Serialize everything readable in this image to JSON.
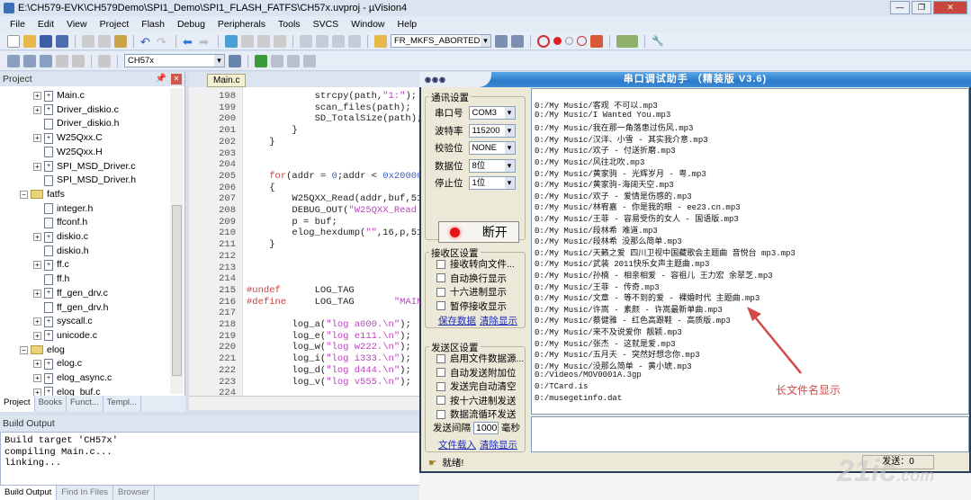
{
  "window": {
    "title": "E:\\CH579-EVK\\CH579Demo\\SPI1_Demo\\SPI1_FLASH_FATFS\\CH57x.uvproj - µVision4"
  },
  "menu": [
    "File",
    "Edit",
    "View",
    "Project",
    "Flash",
    "Debug",
    "Peripherals",
    "Tools",
    "SVCS",
    "Window",
    "Help"
  ],
  "toolbar": {
    "find_combo": "FR_MKFS_ABORTED",
    "target_combo": "CH57x"
  },
  "project": {
    "title": "Project",
    "items": [
      {
        "label": "Main.c",
        "type": "c",
        "level": 2,
        "exp": "+"
      },
      {
        "label": "Driver_diskio.c",
        "type": "c",
        "level": 2,
        "exp": "+"
      },
      {
        "label": "Driver_diskio.h",
        "type": "h",
        "level": 2
      },
      {
        "label": "W25Qxx.C",
        "type": "c",
        "level": 2,
        "exp": "+"
      },
      {
        "label": "W25Qxx.H",
        "type": "h",
        "level": 2
      },
      {
        "label": "SPI_MSD_Driver.c",
        "type": "c",
        "level": 2,
        "exp": "+"
      },
      {
        "label": "SPI_MSD_Driver.h",
        "type": "h",
        "level": 2
      },
      {
        "label": "fatfs",
        "type": "folder",
        "level": 1,
        "exp": "−"
      },
      {
        "label": "integer.h",
        "type": "h",
        "level": 2
      },
      {
        "label": "ffconf.h",
        "type": "h",
        "level": 2
      },
      {
        "label": "diskio.c",
        "type": "c",
        "level": 2,
        "exp": "+"
      },
      {
        "label": "diskio.h",
        "type": "h",
        "level": 2
      },
      {
        "label": "ff.c",
        "type": "c",
        "level": 2,
        "exp": "+"
      },
      {
        "label": "ff.h",
        "type": "h",
        "level": 2
      },
      {
        "label": "ff_gen_drv.c",
        "type": "c",
        "level": 2,
        "exp": "+"
      },
      {
        "label": "ff_gen_drv.h",
        "type": "h",
        "level": 2
      },
      {
        "label": "syscall.c",
        "type": "c",
        "level": 2,
        "exp": "+"
      },
      {
        "label": "unicode.c",
        "type": "c",
        "level": 2,
        "exp": "+"
      },
      {
        "label": "elog",
        "type": "folder",
        "level": 1,
        "exp": "−"
      },
      {
        "label": "elog.c",
        "type": "c",
        "level": 2,
        "exp": "+"
      },
      {
        "label": "elog_async.c",
        "type": "c",
        "level": 2,
        "exp": "+"
      },
      {
        "label": "elog_buf.c",
        "type": "c",
        "level": 2,
        "exp": "+"
      }
    ],
    "tabs": [
      "Project",
      "Books",
      "Funct...",
      "Templ..."
    ]
  },
  "editor": {
    "tab": "Main.c",
    "lines": [
      {
        "n": "198",
        "html": "            strcpy(path,<span class='str'>\"1:\"</span>);"
      },
      {
        "n": "199",
        "html": "            scan_files(path);"
      },
      {
        "n": "200",
        "html": "            SD_TotalSize(path);"
      },
      {
        "n": "201",
        "html": "        }"
      },
      {
        "n": "202",
        "html": "    }"
      },
      {
        "n": "203",
        "html": ""
      },
      {
        "n": "204",
        "html": ""
      },
      {
        "n": "205",
        "html": "    <span class='kw'>for</span>(addr = <span class='num'>0</span>;addr &lt; <span class='num'>0x20000</span>"
      },
      {
        "n": "206",
        "html": "    {"
      },
      {
        "n": "207",
        "html": "        W25QXX_Read(addr,buf,51"
      },
      {
        "n": "208",
        "html": "        DEBUG_OUT(<span class='str'>\"W25QXX_Read</span>"
      },
      {
        "n": "209",
        "html": "        p = buf;"
      },
      {
        "n": "210",
        "html": "        elog_hexdump(<span class='str'>\"\"</span>,16,p,51"
      },
      {
        "n": "211",
        "html": "    }"
      },
      {
        "n": "212",
        "html": ""
      },
      {
        "n": "213",
        "html": ""
      },
      {
        "n": "214",
        "html": ""
      },
      {
        "n": "215",
        "html": "<span class='kw'>#undef</span>      LOG_TAG"
      },
      {
        "n": "216",
        "html": "<span class='kw'>#define</span>     LOG_TAG       <span class='str'>\"MAIN-T</span>"
      },
      {
        "n": "217",
        "html": ""
      },
      {
        "n": "218",
        "html": "        log_a(<span class='str'>\"log a000.\\n\"</span>);"
      },
      {
        "n": "219",
        "html": "        log_e(<span class='str'>\"log e111.\\n\"</span>);"
      },
      {
        "n": "220",
        "html": "        log_w(<span class='str'>\"log w222.\\n\"</span>);"
      },
      {
        "n": "221",
        "html": "        log_i(<span class='str'>\"log i333.\\n\"</span>);"
      },
      {
        "n": "222",
        "html": "        log_d(<span class='str'>\"log d444.\\n\"</span>);"
      },
      {
        "n": "223",
        "html": "        log_v(<span class='str'>\"log v555.\\n\"</span>);"
      },
      {
        "n": "224",
        "html": ""
      }
    ]
  },
  "build": {
    "title": "Build Output",
    "text": "Build target 'CH57x'\ncompiling Main.c...\nlinking...",
    "tabs": [
      "Build Output",
      "Find In Files",
      "Browser"
    ]
  },
  "serial": {
    "title": "串口调试助手 （精装版 V3.6)",
    "comm_group": "通讯设置",
    "fields": [
      {
        "label": "串口号",
        "value": "COM3"
      },
      {
        "label": "波特率",
        "value": "115200"
      },
      {
        "label": "校验位",
        "value": "NONE"
      },
      {
        "label": "数据位",
        "value": "8位"
      },
      {
        "label": "停止位",
        "value": "1位"
      }
    ],
    "disconnect": "断开",
    "recv_group": "接收区设置",
    "recv_checks": [
      "接收转向文件...",
      "自动换行显示",
      "十六进制显示",
      "暂停接收显示"
    ],
    "recv_links": [
      "保存数据",
      "清除显示"
    ],
    "send_group": "发送区设置",
    "send_checks": [
      "启用文件数据源...",
      "自动发送附加位",
      "发送完自动清空",
      "按十六进制发送",
      "数据流循环发送"
    ],
    "interval_label": "发送间隔",
    "interval_value": "1000",
    "interval_unit": "毫秒",
    "send_links": [
      "文件载入",
      "清除显示"
    ],
    "status": "就绪!",
    "send_count": "发送：0",
    "received": [
      "0:/My Music/客观 不可以.mp3",
      "0:/My Music/I Wanted You.mp3",
      "0:/My Music/我在那一角落患过伤风.mp3",
      "0:/My Music/汉洋、小雪 - 其实我介意.mp3",
      "0:/My Music/欢子 - 付送折磨.mp3",
      "0:/My Music/风往北吹.mp3",
      "0:/My Music/黄家驹 - 光辉岁月 - 粤.mp3",
      "0:/My Music/黄家驹-海阔天空.mp3",
      "0:/My Music/欢子 - 爱情是伤感的.mp3",
      "0:/My Music/林宥嘉 - 你是我的眼 - ee23.cn.mp3",
      "0:/My Music/王菲 - 容易受伤的女人 - 国语版.mp3",
      "0:/My Music/段林希 难道.mp3",
      "0:/My Music/段林希 没那么简单.mp3",
      "0:/My Music/天籁之爱 四川卫视中国藏歌会主题曲 音悦台 mp3.mp3",
      "0:/My Music/武装 2011快乐女声主题曲.mp3",
      "0:/My Music/孙楠 - 相亲相爱 - 容祖儿 王力宏 余翠芝.mp3",
      "0:/My Music/王菲 - 传奇.mp3",
      "0:/My Music/文章 - 等不到的爱 - 裸婚时代 主题曲.mp3",
      "0:/My Music/许嵩 - 素颜 - 许嵩最新单曲.mp3",
      "0:/My Music/蔡健雅 - 红色高跟鞋 - 高质版.mp3",
      "0:/My Music/来不及说爱你 靓颖.mp3",
      "0:/My Music/张杰 - 这就是爱.mp3",
      "0:/My Music/五月天 - 突然好想念你.mp3",
      "0:/My Music/没那么简单 - 黄小琥.mp3",
      "0:/Videos/MOV0001A.3gp",
      "0:/TCard.is",
      "0:/musegetinfo.dat"
    ]
  },
  "annotation": "长文件名显示",
  "watermark": "21ic.com 中国电子网",
  "colors": {
    "title_blue": "#2c7bc9",
    "arrow_red": "#d24a4a",
    "keyword": "#c8423f",
    "string": "#c040c0"
  }
}
